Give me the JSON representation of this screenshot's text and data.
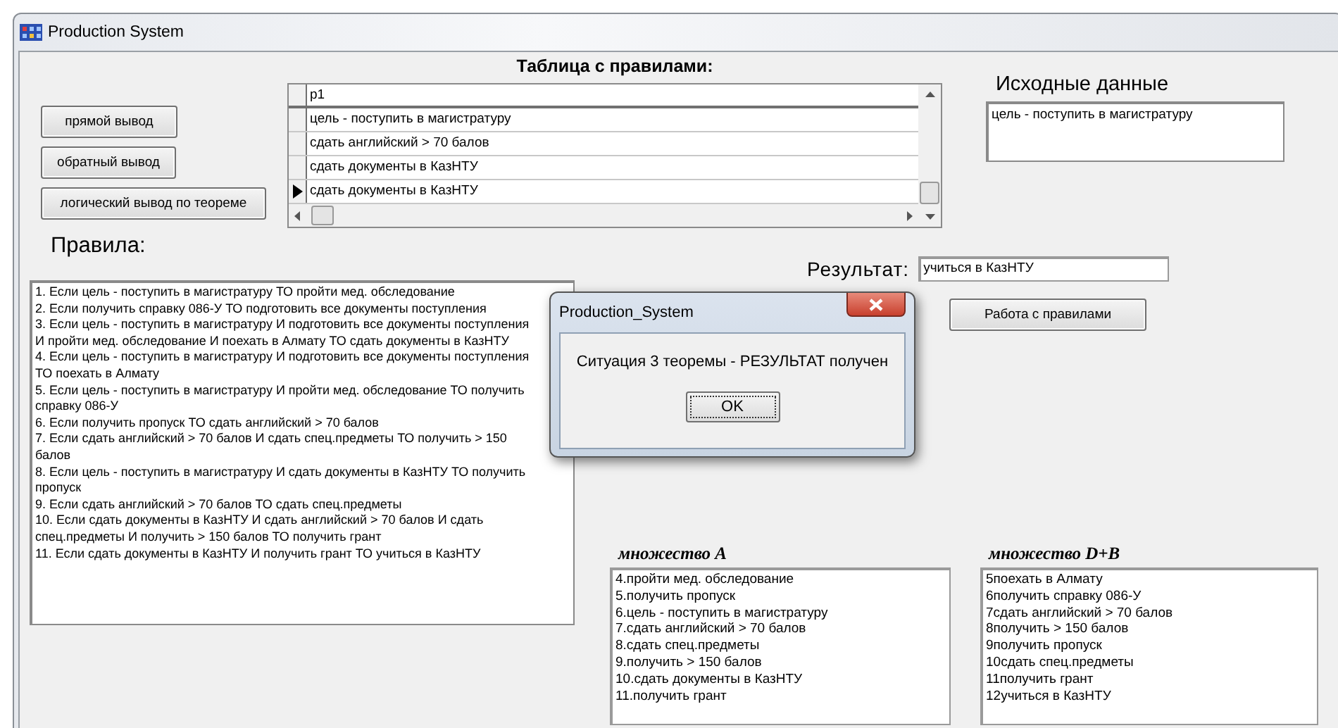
{
  "window": {
    "title": "Production System"
  },
  "actions": [
    {
      "label": "прямой вывод"
    },
    {
      "label": "обратный вывод"
    },
    {
      "label": "логический вывод по теореме"
    }
  ],
  "table": {
    "title": "Таблица с правилами:",
    "column": "p1",
    "rows": [
      {
        "text": "цель - поступить в магистратуру",
        "current": false
      },
      {
        "text": "сдать английский > 70 балов",
        "current": false
      },
      {
        "text": "сдать документы в КазНТУ",
        "current": false
      },
      {
        "text": "сдать документы в КазНТУ",
        "current": true
      }
    ]
  },
  "source": {
    "label": "Исходные данные",
    "value": "цель - поступить в магистратуру"
  },
  "rules": {
    "label": "Правила:",
    "lines": [
      "1. Если цель - поступить в магистратуру ТО пройти мед. обследование",
      "2. Если получить справку 086-У ТО подготовить все документы поступления",
      "3. Если цель - поступить в магистратуру И подготовить все документы поступления И пройти мед. обследование И поехать в Алмату ТО сдать документы в КазНТУ",
      "4. Если цель - поступить в магистратуру И подготовить все документы поступления ТО поехать в Алмату",
      "5. Если цель - поступить в магистратуру И пройти мед. обследование ТО получить справку 086-У",
      "6. Если получить пропуск ТО сдать английский > 70 балов",
      "7. Если сдать английский > 70 балов И сдать спец.предметы ТО получить > 150 балов",
      "8. Если цель - поступить в магистратуру И сдать документы в КазНТУ ТО получить пропуск",
      "9. Если сдать английский > 70 балов ТО сдать спец.предметы",
      "10. Если сдать документы в КазНТУ И сдать английский > 70 балов И сдать спец.предметы И получить > 150 балов ТО получить грант",
      "11. Если сдать документы в КазНТУ И получить грант ТО учиться в КазНТУ"
    ]
  },
  "result": {
    "label": "Результат:",
    "value": "учиться в КазНТУ"
  },
  "work_button": {
    "label": "Работа с правилами"
  },
  "sets": [
    {
      "title": "множество A",
      "items": [
        "4.пройти мед. обследование",
        "5.получить пропуск",
        "6.цель - поступить в магистратуру",
        "7.сдать английский > 70 балов",
        "8.сдать спец.предметы",
        "9.получить > 150 балов",
        "10.сдать документы в КазНТУ",
        "11.получить грант"
      ]
    },
    {
      "title": "множество D+B",
      "items": [
        "5поехать в Алмату",
        "6получить справку 086-У",
        "7сдать английский > 70 балов",
        "8получить > 150 балов",
        "9получить пропуск",
        "10сдать спец.предметы",
        "11получить грант",
        "12учиться в КазНТУ"
      ]
    }
  ],
  "dialog": {
    "title": "Production_System",
    "message": "Ситуация 3 теоремы - РЕЗУЛЬТАТ получен",
    "button": "OK"
  }
}
